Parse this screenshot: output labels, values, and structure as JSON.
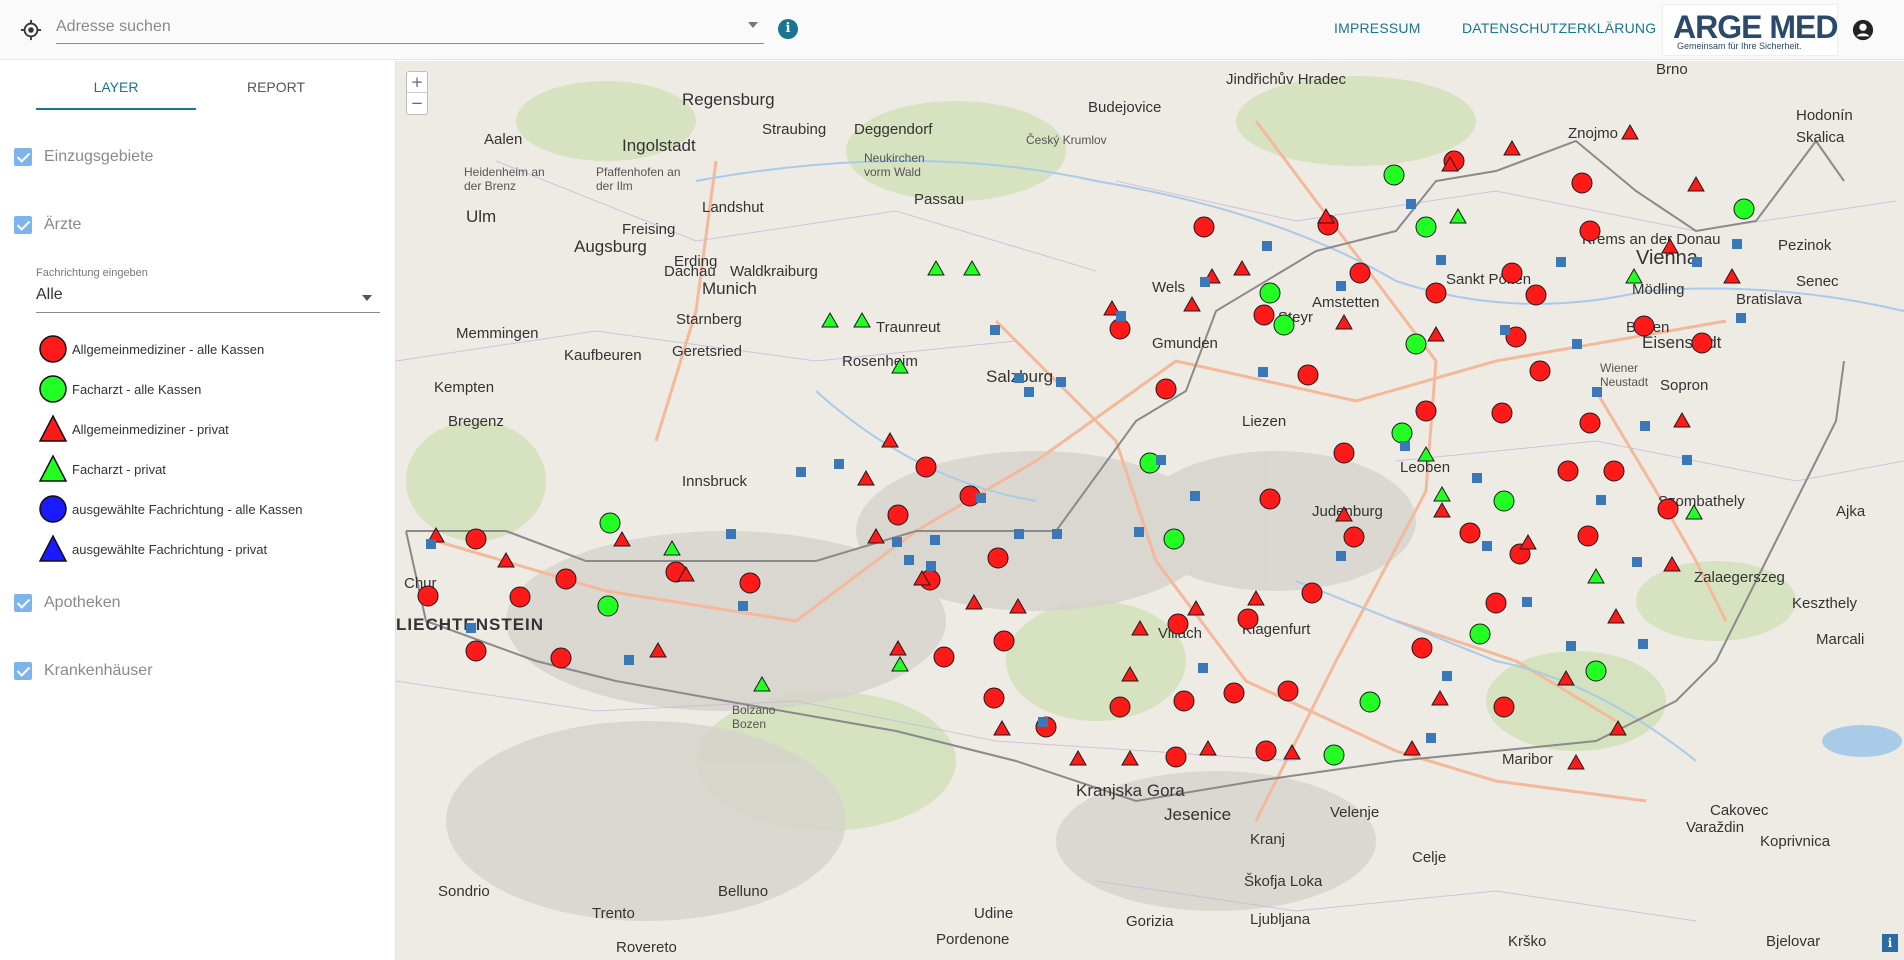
{
  "header": {
    "search_placeholder": "Adresse suchen",
    "impressum": "IMPRESSUM",
    "datenschutz": "DATENSCHUTZERKLÄRUNG",
    "logo_text": "ARGE MED",
    "logo_tagline": "Gemeinsam für Ihre Sicherheit."
  },
  "sidebar": {
    "tabs": [
      {
        "label": "LAYER",
        "active": true
      },
      {
        "label": "REPORT",
        "active": false
      }
    ],
    "layers": [
      {
        "label": "Einzugsgebiete",
        "checked": true
      },
      {
        "label": "Ärzte",
        "checked": true
      },
      {
        "label": "Apotheken",
        "checked": true
      },
      {
        "label": "Krankenhäuser",
        "checked": true
      }
    ],
    "fachrichtung_label": "Fachrichtung eingeben",
    "fachrichtung_value": "Alle",
    "legend": [
      {
        "label": "Allgemeinmediziner - alle Kassen",
        "shape": "circle",
        "color": "#ff1a1a"
      },
      {
        "label": "Facharzt - alle Kassen",
        "shape": "circle",
        "color": "#22ff22"
      },
      {
        "label": "Allgemeinmediziner - privat",
        "shape": "triangle",
        "color": "#ff1a1a"
      },
      {
        "label": "Facharzt - privat",
        "shape": "triangle",
        "color": "#22ff22"
      },
      {
        "label": "ausgewählte Fachrichtung - alle Kassen",
        "shape": "circle",
        "color": "#1a1aff"
      },
      {
        "label": "ausgewählte Fachrichtung - privat",
        "shape": "triangle",
        "color": "#1a1aff"
      }
    ]
  },
  "map": {
    "zoom_in": "+",
    "zoom_out": "−",
    "attribution": "i",
    "places": [
      {
        "name": "Regensburg"
      },
      {
        "name": "Ingolstadt"
      },
      {
        "name": "Straubing"
      },
      {
        "name": "Deggendorf"
      },
      {
        "name": "Budejovice"
      },
      {
        "name": "Jindřichův Hradec"
      },
      {
        "name": "Český Krumlov"
      },
      {
        "name": "Znojmo"
      },
      {
        "name": "Brno"
      },
      {
        "name": "Hodonín"
      },
      {
        "name": "Skalica"
      },
      {
        "name": "Aalen"
      },
      {
        "name": "Heidenheim an der Brenz"
      },
      {
        "name": "Pfaffenhofen an der Ilm"
      },
      {
        "name": "Neukirchen vorm Wald"
      },
      {
        "name": "Passau"
      },
      {
        "name": "Landshut"
      },
      {
        "name": "Ulm"
      },
      {
        "name": "Augsburg"
      },
      {
        "name": "Freising"
      },
      {
        "name": "Erding"
      },
      {
        "name": "Dachau"
      },
      {
        "name": "Munich"
      },
      {
        "name": "Waldkraiburg"
      },
      {
        "name": "Krems an der Donau"
      },
      {
        "name": "Vienna"
      },
      {
        "name": "Pezinok"
      },
      {
        "name": "Bratislava"
      },
      {
        "name": "Senec"
      },
      {
        "name": "Memmingen"
      },
      {
        "name": "Starnberg"
      },
      {
        "name": "Traunreut"
      },
      {
        "name": "Wels"
      },
      {
        "name": "Amstetten"
      },
      {
        "name": "Sankt Pölten"
      },
      {
        "name": "Mödling"
      },
      {
        "name": "Kaufbeuren"
      },
      {
        "name": "Geretsried"
      },
      {
        "name": "Rosenheim"
      },
      {
        "name": "Steyr"
      },
      {
        "name": "Gmunden"
      },
      {
        "name": "Baden"
      },
      {
        "name": "Eisenstadt"
      },
      {
        "name": "Kempten"
      },
      {
        "name": "Salzburg"
      },
      {
        "name": "Wiener Neustadt"
      },
      {
        "name": "Sopron"
      },
      {
        "name": "Bregenz"
      },
      {
        "name": "Innsbruck"
      },
      {
        "name": "Liezen"
      },
      {
        "name": "Leoben"
      },
      {
        "name": "Szombathely"
      },
      {
        "name": "Judenburg"
      },
      {
        "name": "Ajka"
      },
      {
        "name": "Zalaegerszeg"
      },
      {
        "name": "Keszthely"
      },
      {
        "name": "Chur"
      },
      {
        "name": "Villach"
      },
      {
        "name": "Klagenfurt"
      },
      {
        "name": "Maribor"
      },
      {
        "name": "Marcali"
      },
      {
        "name": "Bolzano Bozen"
      },
      {
        "name": "Kranjska Gora"
      },
      {
        "name": "Jesenice"
      },
      {
        "name": "Velenje"
      },
      {
        "name": "Cakovec"
      },
      {
        "name": "Varaždin"
      },
      {
        "name": "Koprivnica"
      },
      {
        "name": "Kranj"
      },
      {
        "name": "Celje"
      },
      {
        "name": "Sondrio"
      },
      {
        "name": "Belluno"
      },
      {
        "name": "Udine"
      },
      {
        "name": "Škofja Loka"
      },
      {
        "name": "Ljubljana"
      },
      {
        "name": "Trento"
      },
      {
        "name": "Gorizia"
      },
      {
        "name": "Pordenone"
      },
      {
        "name": "Rovereto"
      },
      {
        "name": "Krško"
      },
      {
        "name": "Bjelovar"
      },
      {
        "name": "LIECHTENSTEIN"
      }
    ]
  }
}
